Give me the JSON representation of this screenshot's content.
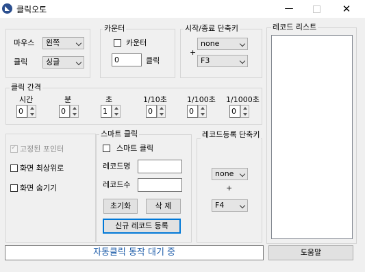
{
  "window": {
    "title": "클릭오토"
  },
  "mouse_group": {
    "mouse_label": "마우스",
    "mouse_value": "왼쪽",
    "click_label": "클릭",
    "click_value": "싱글"
  },
  "counter_group": {
    "title": "카운터",
    "checkbox_label": "카운터",
    "count_value": "0",
    "count_unit": "클릭"
  },
  "hotkey_group": {
    "title": "시작/종료 단축키",
    "modifier_value": "none",
    "plus": "+",
    "key_value": "F3"
  },
  "record_list": {
    "title": "레코드 리스트"
  },
  "interval_group": {
    "title": "클릭 간격",
    "fields": [
      {
        "label": "시간",
        "value": "0"
      },
      {
        "label": "분",
        "value": "0"
      },
      {
        "label": "초",
        "value": "1"
      },
      {
        "label": "1/10초",
        "value": "0"
      },
      {
        "label": "1/100초",
        "value": "0"
      },
      {
        "label": "1/1000초",
        "value": "0"
      }
    ]
  },
  "options_group": {
    "fixed_pointer_label": "고정된 포인터",
    "top_most_label": "화면 최상위로",
    "hide_screen_label": "화면 숨기기"
  },
  "smart_click_group": {
    "title": "스마트 클릭",
    "checkbox_label": "스마트 클릭",
    "record_name_label": "레코드명",
    "record_name_value": "",
    "record_count_label": "레코드수",
    "record_count_value": "",
    "reset_button": "초기화",
    "delete_button": "삭 제",
    "new_record_button": "신규 레코드 등록"
  },
  "record_hotkey_group": {
    "title": "레코드등록 단축키",
    "modifier_value": "none",
    "plus": "+",
    "key_value": "F4"
  },
  "status": {
    "text": "자동클릭 동작 대기 중"
  },
  "help_button": "도움말"
}
